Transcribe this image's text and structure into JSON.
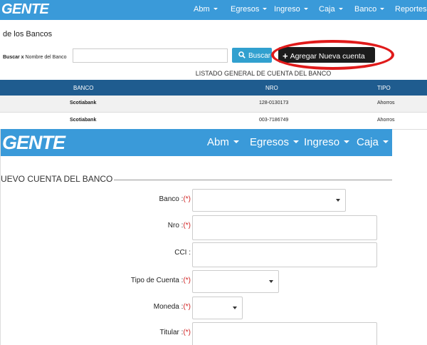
{
  "list_view": {
    "logo": "GENTE",
    "nav": [
      {
        "label": "Abm"
      },
      {
        "label": "Egresos"
      },
      {
        "label": "Ingreso"
      },
      {
        "label": "Caja"
      },
      {
        "label": "Banco"
      },
      {
        "label": "Reportes"
      }
    ],
    "page_title": "de los Bancos",
    "search": {
      "label_bold": "Buscar x",
      "label_rest": "Nombre del Banco",
      "value": "",
      "button": "Buscar"
    },
    "add_button": "Agregar Nueva cuenta",
    "list_title": "LISTADO GENERAL DE CUENTA DEL BANCO",
    "columns": [
      "BANCO",
      "NRO",
      "TIPO"
    ],
    "rows": [
      {
        "banco": "Scotiabank",
        "nro": "128-0130173",
        "tipo": "Ahorros"
      },
      {
        "banco": "Scotiabank",
        "nro": "003-7186749",
        "tipo": "Ahorros"
      }
    ]
  },
  "form_view": {
    "logo": "GENTE",
    "nav": [
      {
        "label": "Abm"
      },
      {
        "label": "Egresos"
      },
      {
        "label": "Ingreso"
      },
      {
        "label": "Caja"
      }
    ],
    "legend": "UEVO CUENTA DEL BANCO",
    "required_mark": "(*)",
    "fields": {
      "banco": {
        "label": "Banco :",
        "value": ""
      },
      "nro": {
        "label": "Nro :",
        "value": ""
      },
      "cci": {
        "label": "CCI :",
        "value": ""
      },
      "tipo": {
        "label": "Tipo de Cuenta :",
        "value": ""
      },
      "moneda": {
        "label": "Moneda :",
        "value": ""
      },
      "titular": {
        "label": "Titular :",
        "value": ""
      }
    }
  },
  "colors": {
    "navbar": "#3a9ad9",
    "table_header": "#1f5c8f",
    "search_button": "#31a0cf",
    "add_button": "#1c1c1c",
    "highlight_ring": "#e01a1a",
    "required": "#d02020"
  }
}
